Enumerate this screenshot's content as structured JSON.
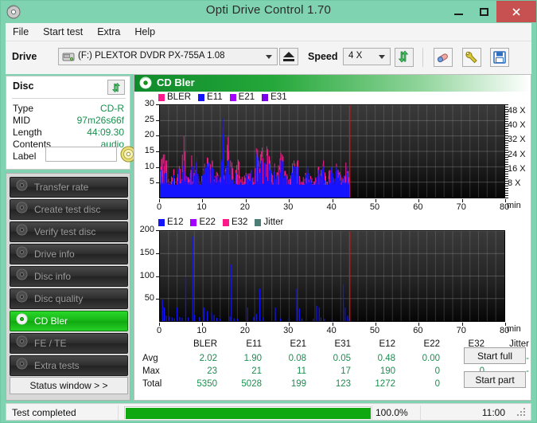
{
  "window": {
    "title": "Opti Drive Control 1.70",
    "app_icon": "disc-icon",
    "minimize": "–",
    "maximize": "□",
    "close": "✕"
  },
  "menu": {
    "items": [
      {
        "label": "File",
        "name": "menu-file"
      },
      {
        "label": "Start test",
        "name": "menu-start-test"
      },
      {
        "label": "Extra",
        "name": "menu-extra"
      },
      {
        "label": "Help",
        "name": "menu-help"
      }
    ]
  },
  "drivebar": {
    "drive_label": "Drive",
    "drive_value": "(F:)   PLEXTOR DVDR   PX-755A 1.08",
    "speed_label": "Speed",
    "speed_value": "4 X",
    "icons": {
      "eject": "eject-icon",
      "refresh": "refresh-icon",
      "eraser": "eraser-icon",
      "wrench": "wrench-icon",
      "save": "save-icon"
    }
  },
  "disc": {
    "title": "Disc",
    "refresh_icon": "refresh-icon",
    "rows": [
      {
        "key": "Type",
        "value": "CD-R"
      },
      {
        "key": "MID",
        "value": "97m26s66f"
      },
      {
        "key": "Length",
        "value": "44:09.30"
      },
      {
        "key": "Contents",
        "value": "audio"
      }
    ],
    "label_key": "Label",
    "label_value": "",
    "label_placeholder": "",
    "label_button_icon": "cd-icon"
  },
  "sidebar": {
    "items": [
      {
        "label": "Transfer rate",
        "name": "sidebar-item-transfer-rate",
        "icon": "disc-icon",
        "active": false
      },
      {
        "label": "Create test disc",
        "name": "sidebar-item-create-test-disc",
        "icon": "disc-write-icon",
        "active": false
      },
      {
        "label": "Verify test disc",
        "name": "sidebar-item-verify-test-disc",
        "icon": "disc-check-icon",
        "active": false
      },
      {
        "label": "Drive info",
        "name": "sidebar-item-drive-info",
        "icon": "drive-icon",
        "active": false
      },
      {
        "label": "Disc info",
        "name": "sidebar-item-disc-info",
        "icon": "disc-info-icon",
        "active": false
      },
      {
        "label": "Disc quality",
        "name": "sidebar-item-disc-quality",
        "icon": "disc-icon",
        "active": false
      },
      {
        "label": "CD Bler",
        "name": "sidebar-item-cd-bler",
        "icon": "disc-icon",
        "active": true
      },
      {
        "label": "FE / TE",
        "name": "sidebar-item-fe-te",
        "icon": "disc-icon",
        "active": false
      },
      {
        "label": "Extra tests",
        "name": "sidebar-item-extra-tests",
        "icon": "disc-icon",
        "active": false
      }
    ],
    "status_window": "Status window > >"
  },
  "panel": {
    "title": "CD Bler",
    "icon": "disc-icon"
  },
  "chart_data": [
    {
      "type": "line",
      "name": "top-chart",
      "title": "CD Bler",
      "legend": [
        {
          "label": "BLER",
          "color": "#ff1a8c"
        },
        {
          "label": "E11",
          "color": "#1414ff"
        },
        {
          "label": "E21",
          "color": "#a400ff"
        },
        {
          "label": "E31",
          "color": "#7a00e6"
        }
      ],
      "legend_position": "top-left",
      "xlabel": "min",
      "ylabel": "",
      "xlim": [
        0,
        80
      ],
      "ylim": [
        0,
        30
      ],
      "xticks": [
        0,
        10,
        20,
        30,
        40,
        50,
        60,
        70,
        80
      ],
      "yticks": [
        5,
        10,
        15,
        20,
        25,
        30
      ],
      "y2label": "X",
      "y2ticks": [
        "8 X",
        "16 X",
        "24 X",
        "32 X",
        "40 X",
        "48 X"
      ],
      "y2lim": [
        0,
        52
      ],
      "grid": true,
      "data_end_min": 44.1,
      "marker_line_min": 44.1,
      "marker_color": "#ff0000",
      "series": [
        {
          "name": "BLER",
          "color": "#ff1a8c",
          "x": [
            0.3,
            0.8,
            1.4,
            2.0,
            2.6,
            3.2,
            3.8,
            4.4,
            5.0,
            5.6,
            6.2,
            6.8,
            7.4,
            8.0,
            8.6,
            9.2,
            9.8,
            10.4,
            11.0,
            11.6,
            12.2,
            12.8,
            13.4,
            14.0,
            14.6,
            15.2,
            15.8,
            16.4,
            17.0,
            17.6,
            18.2,
            18.8,
            19.4,
            20.0,
            20.6,
            21.2,
            21.8,
            22.4,
            23.0,
            23.6,
            24.2,
            24.8,
            25.4,
            26.0,
            26.6,
            27.2,
            27.8,
            28.4,
            29.0,
            29.6,
            30.2,
            30.8,
            31.4,
            32.0,
            32.6,
            33.2,
            33.8,
            34.4,
            35.0,
            35.6,
            36.2,
            36.8,
            37.4,
            38.0,
            38.6,
            39.2,
            39.8,
            40.4,
            41.0,
            41.6,
            42.2,
            42.8,
            43.4,
            44.0
          ],
          "y": [
            10,
            14,
            12,
            6,
            5,
            9,
            4,
            9,
            6,
            20,
            7,
            5,
            12,
            8,
            10,
            4,
            6,
            11,
            13,
            11,
            12,
            7,
            8,
            5,
            23,
            9,
            16,
            12,
            7,
            9,
            12,
            6,
            5,
            8,
            7,
            9,
            4,
            16,
            12,
            15,
            10,
            14,
            13,
            6,
            9,
            8,
            10,
            14,
            8,
            7,
            5,
            9,
            11,
            12,
            6,
            5,
            8,
            9,
            7,
            4,
            6,
            10,
            8,
            12,
            5,
            7,
            9,
            6,
            11,
            8,
            5,
            7,
            10,
            6
          ]
        },
        {
          "name": "E11",
          "color": "#1414ff",
          "x": [
            0.3,
            0.8,
            1.4,
            2.0,
            2.6,
            3.2,
            3.8,
            4.4,
            5.0,
            5.6,
            6.2,
            6.8,
            7.4,
            8.0,
            8.6,
            9.2,
            9.8,
            10.4,
            11.0,
            11.6,
            12.2,
            12.8,
            13.4,
            14.0,
            14.6,
            15.2,
            15.8,
            16.4,
            17.0,
            17.6,
            18.2,
            18.8,
            19.4,
            20.0,
            20.6,
            21.2,
            21.8,
            22.4,
            23.0,
            23.6,
            24.2,
            24.8,
            25.4,
            26.0,
            26.6,
            27.2,
            27.8,
            28.4,
            29.0,
            29.6,
            30.2,
            30.8,
            31.4,
            32.0,
            32.6,
            33.2,
            33.8,
            34.4,
            35.0,
            35.6,
            36.2,
            36.8,
            37.4,
            38.0,
            38.6,
            39.2,
            39.8,
            40.4,
            41.0,
            41.6,
            42.2,
            42.8,
            43.4,
            44.0
          ],
          "y": [
            9,
            11,
            8,
            5,
            4,
            7,
            4,
            8,
            5,
            12,
            6,
            5,
            10,
            7,
            13,
            4,
            5,
            10,
            11,
            9,
            10,
            6,
            7,
            5,
            21,
            8,
            12,
            10,
            6,
            8,
            9,
            5,
            4,
            7,
            6,
            8,
            4,
            14,
            10,
            12,
            9,
            12,
            11,
            5,
            8,
            7,
            9,
            12,
            7,
            6,
            4,
            8,
            10,
            10,
            5,
            4,
            7,
            8,
            6,
            4,
            5,
            9,
            7,
            10,
            4,
            6,
            8,
            5,
            10,
            7,
            4,
            6,
            9,
            5
          ]
        }
      ]
    },
    {
      "type": "line",
      "name": "bottom-chart",
      "legend": [
        {
          "label": "E12",
          "color": "#1414ff"
        },
        {
          "label": "E22",
          "color": "#a400ff"
        },
        {
          "label": "E32",
          "color": "#ff1a8c"
        },
        {
          "label": "Jitter",
          "color": "#4d7d74"
        }
      ],
      "legend_position": "top-left",
      "xlabel": "min",
      "ylabel": "",
      "xlim": [
        0,
        80
      ],
      "ylim": [
        0,
        200
      ],
      "xticks": [
        0,
        10,
        20,
        30,
        40,
        50,
        60,
        70,
        80
      ],
      "yticks": [
        50,
        100,
        150,
        200
      ],
      "grid": true,
      "data_end_min": 44.1,
      "marker_line_min": 44.1,
      "marker_color": "#ff0000",
      "series": [
        {
          "name": "E12",
          "color": "#1414ff",
          "x": [
            0.6,
            1.0,
            1.5,
            2.2,
            2.8,
            3.4,
            4.0,
            4.6,
            5.2,
            6.0,
            6.6,
            7.6,
            8.0,
            9.2,
            10.2,
            11.0,
            12.0,
            12.6,
            13.2,
            14.0,
            16.3,
            16.6,
            17.2,
            18.0,
            20.4,
            21.8,
            22.4,
            23.2,
            24.0,
            26.8,
            28.0,
            30.0,
            31.8,
            32.4,
            33.0,
            35.6,
            36.4,
            37.0,
            37.4,
            38.2,
            40.0,
            42.6,
            43.0,
            43.6,
            44.0
          ],
          "y": [
            47,
            30,
            12,
            10,
            8,
            6,
            30,
            9,
            7,
            98,
            8,
            188,
            14,
            9,
            30,
            22,
            18,
            14,
            7,
            5,
            10,
            126,
            6,
            5,
            30,
            9,
            16,
            72,
            8,
            30,
            6,
            7,
            72,
            28,
            6,
            5,
            34,
            30,
            8,
            5,
            4,
            82,
            30,
            12,
            6
          ]
        }
      ]
    }
  ],
  "stats": {
    "columns": [
      "BLER",
      "E11",
      "E21",
      "E31",
      "E12",
      "E22",
      "E32",
      "Jitter"
    ],
    "rows": [
      {
        "label": "Avg",
        "values": [
          "2.02",
          "1.90",
          "0.08",
          "0.05",
          "0.48",
          "0.00",
          "0.00",
          "-"
        ]
      },
      {
        "label": "Max",
        "values": [
          "23",
          "21",
          "11",
          "17",
          "190",
          "0",
          "0",
          "-"
        ]
      },
      {
        "label": "Total",
        "values": [
          "5350",
          "5028",
          "199",
          "123",
          "1272",
          "0",
          "0",
          ""
        ]
      }
    ],
    "start_full": "Start full",
    "start_part": "Start part"
  },
  "statusbar": {
    "text": "Test completed",
    "progress_pct": "100.0%",
    "progress_value": 100,
    "elapsed": "11:00"
  }
}
